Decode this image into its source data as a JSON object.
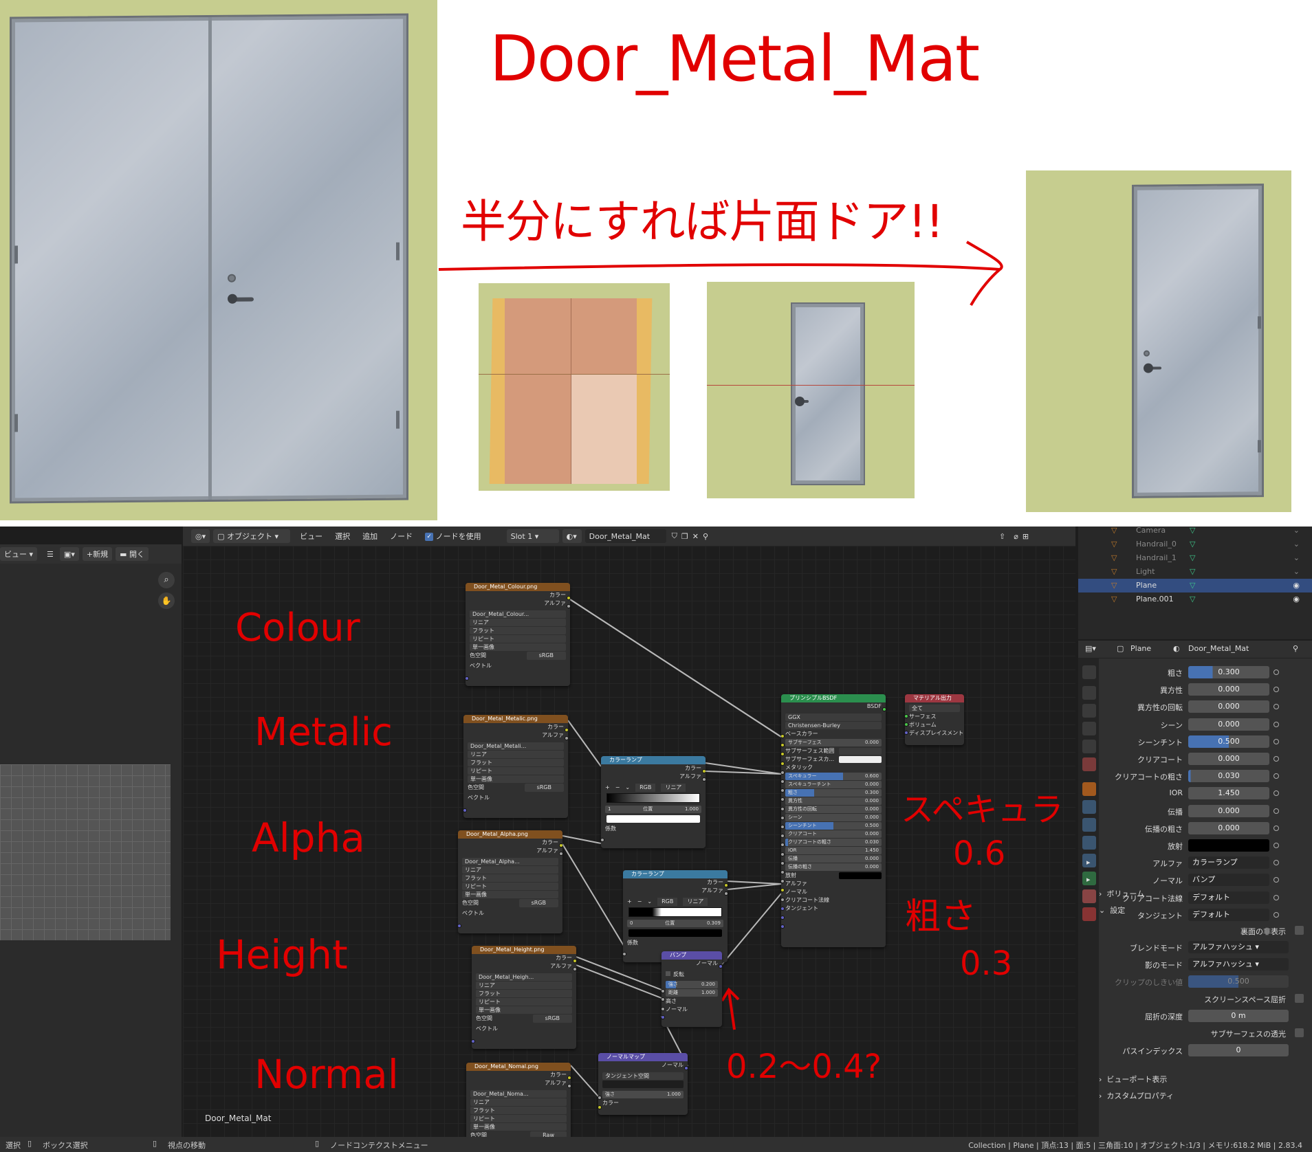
{
  "annotations": {
    "title": "Door_Metal_Mat",
    "note_line1": "半分にすれば片面ドア!!",
    "tex_labels": [
      "Colour",
      "Metalic",
      "Alpha",
      "Height",
      "Normal"
    ],
    "specular_note": "スペキュラ",
    "specular_val": "0.6",
    "rough_note": "粗さ",
    "rough_val": "0.3",
    "bump_note": "0.2〜0.4?"
  },
  "header": {
    "left_view": "ビュー",
    "new": "新規",
    "open": "開く",
    "mode": "オブジェクト",
    "menus": [
      "ビュー",
      "選択",
      "追加",
      "ノード"
    ],
    "use_nodes": "ノードを使用",
    "slot": "Slot 1",
    "material": "Door_Metal_Mat"
  },
  "outliner": [
    {
      "name": "Camera"
    },
    {
      "name": "Handrail_0"
    },
    {
      "name": "Handrail_1"
    },
    {
      "name": "Light"
    },
    {
      "name": "Plane"
    },
    {
      "name": "Plane.001"
    }
  ],
  "props": {
    "object": "Plane",
    "material": "Door_Metal_Mat",
    "rows": [
      {
        "label": "粗さ",
        "value": "0.300",
        "pct": 0.3
      },
      {
        "label": "異方性",
        "value": "0.000",
        "pct": 0
      },
      {
        "label": "異方性の回転",
        "value": "0.000",
        "pct": 0
      },
      {
        "label": "シーン",
        "value": "0.000",
        "pct": 0
      },
      {
        "label": "シーンチント",
        "value": "0.500",
        "pct": 0.5
      },
      {
        "label": "クリアコート",
        "value": "0.000",
        "pct": 0
      },
      {
        "label": "クリアコートの粗さ",
        "value": "0.030",
        "pct": 0.03
      },
      {
        "label": "IOR",
        "value": "1.450",
        "pct": 0
      },
      {
        "label": "伝播",
        "value": "0.000",
        "pct": 0
      },
      {
        "label": "伝播の粗さ",
        "value": "0.000",
        "pct": 0
      },
      {
        "label": "放射",
        "value": "",
        "pct": 0
      },
      {
        "label": "アルファ",
        "value": "カラーランプ",
        "pct": 0
      },
      {
        "label": "ノーマル",
        "value": "バンプ",
        "pct": 0
      },
      {
        "label": "クリアコート法線",
        "value": "デフォルト",
        "pct": 0
      },
      {
        "label": "タンジェント",
        "value": "デフォルト",
        "pct": 0
      }
    ],
    "volume": "ボリューム",
    "settings": "設定",
    "backface": "裏面の非表示",
    "blend_label": "ブレンドモード",
    "blend_val": "アルファハッシュ",
    "shadow_label": "影のモード",
    "shadow_val": "アルファハッシュ",
    "clip_label": "クリップのしきい値",
    "clip_val": "0.500",
    "ssr": "スクリーンスペース屈折",
    "refr_label": "屈折の深度",
    "refr_val": "0 m",
    "sss": "サブサーフェスの透光",
    "pass_label": "パスインデックス",
    "pass_val": "0",
    "viewport": "ビューポート表示",
    "custom": "カスタムプロパティ"
  },
  "nodes": {
    "tex": [
      {
        "name": "Door_Metal_Colour.png",
        "img": "Door_Metal_Colour...",
        "cs": "sRGB"
      },
      {
        "name": "Door_Metal_Metalic.png",
        "img": "Door_Metal_Metali...",
        "cs": "sRGB"
      },
      {
        "name": "Door_Metal_Alpha.png",
        "img": "Door_Metal_Alpha...",
        "cs": "sRGB"
      },
      {
        "name": "Door_Metal_Height.png",
        "img": "Door_Metal_Heigh...",
        "cs": "sRGB"
      },
      {
        "name": "Door_Metal_Nomal.png",
        "img": "Door_Metal_Noma...",
        "cs": "Raw"
      }
    ],
    "tex_out": [
      "カラー",
      "アルファ"
    ],
    "tex_opts": [
      "リニア",
      "フラット",
      "リピート",
      "単一画像"
    ],
    "colorspace": "色空間",
    "vector": "ベクトル",
    "ramp_title": "カラーランプ",
    "ramp_mode": "RGB",
    "ramp_interp": "リニア",
    "ramp1_idx": "1",
    "ramp1_pos": "1.000",
    "ramp2_idx": "0",
    "ramp2_pos": "0.309",
    "pos_label": "位置",
    "fac": "係数",
    "bump_title": "バンプ",
    "bump_out": "ノーマル",
    "invert": "反転",
    "strength": "強さ",
    "strength_val": "0.200",
    "distance": "距離",
    "distance_val": "1.000",
    "height": "高さ",
    "normal_in": "ノーマル",
    "nmap_title": "ノーマルマップ",
    "nmap_space": "タンジェント空間",
    "nmap_str_val": "1.000",
    "color_in": "カラー",
    "bsdf_title": "プリンシプルBSDF",
    "bsdf_out": "BSDF",
    "bsdf_dist": "GGX",
    "bsdf_sss": "Christensen-Burley",
    "bsdf_rows": [
      {
        "label": "ベースカラー",
        "value": "",
        "pct": 0
      },
      {
        "label": "サブサーフェス",
        "value": "0.000",
        "pct": 0
      },
      {
        "label": "サブサーフェス範囲",
        "value": "",
        "pct": 0
      },
      {
        "label": "サブサーフェスカ...",
        "value": "",
        "pct": 0
      },
      {
        "label": "メタリック",
        "value": "",
        "pct": 0
      },
      {
        "label": "スペキュラー",
        "value": "0.600",
        "pct": 0.6
      },
      {
        "label": "スペキュラーチント",
        "value": "0.000",
        "pct": 0
      },
      {
        "label": "粗さ",
        "value": "0.300",
        "pct": 0.3
      },
      {
        "label": "異方性",
        "value": "0.000",
        "pct": 0
      },
      {
        "label": "異方性の回転",
        "value": "0.000",
        "pct": 0
      },
      {
        "label": "シーン",
        "value": "0.000",
        "pct": 0
      },
      {
        "label": "シーンチント",
        "value": "0.500",
        "pct": 0.5
      },
      {
        "label": "クリアコート",
        "value": "0.000",
        "pct": 0
      },
      {
        "label": "クリアコートの粗さ",
        "value": "0.030",
        "pct": 0.03
      },
      {
        "label": "IOR",
        "value": "1.450",
        "pct": 0
      },
      {
        "label": "伝播",
        "value": "0.000",
        "pct": 0
      },
      {
        "label": "伝播の粗さ",
        "value": "0.000",
        "pct": 0
      },
      {
        "label": "放射",
        "value": "",
        "pct": 0
      },
      {
        "label": "アルファ",
        "value": "",
        "pct": 0
      },
      {
        "label": "ノーマル",
        "value": "",
        "pct": 0
      },
      {
        "label": "クリアコート法線",
        "value": "",
        "pct": 0
      },
      {
        "label": "タンジェント",
        "value": "",
        "pct": 0
      }
    ],
    "out_title": "マテリアル出力",
    "out_target": "全て",
    "out_rows": [
      "サーフェス",
      "ボリューム",
      "ディスプレイスメント"
    ]
  },
  "node_editor_label": "Door_Metal_Mat",
  "status": {
    "select": "選択",
    "box": "ボックス選択",
    "pan": "視点の移動",
    "ctx": "ノードコンテクストメニュー",
    "info": "Collection | Plane | 頂点:13 | 面:5 | 三角面:10 | オブジェクト:1/3 | メモリ:618.2 MiB | 2.83.4"
  },
  "colors": {
    "selected_row": "#334d80",
    "slider": "#4772b3",
    "annotation": "#e10000"
  }
}
